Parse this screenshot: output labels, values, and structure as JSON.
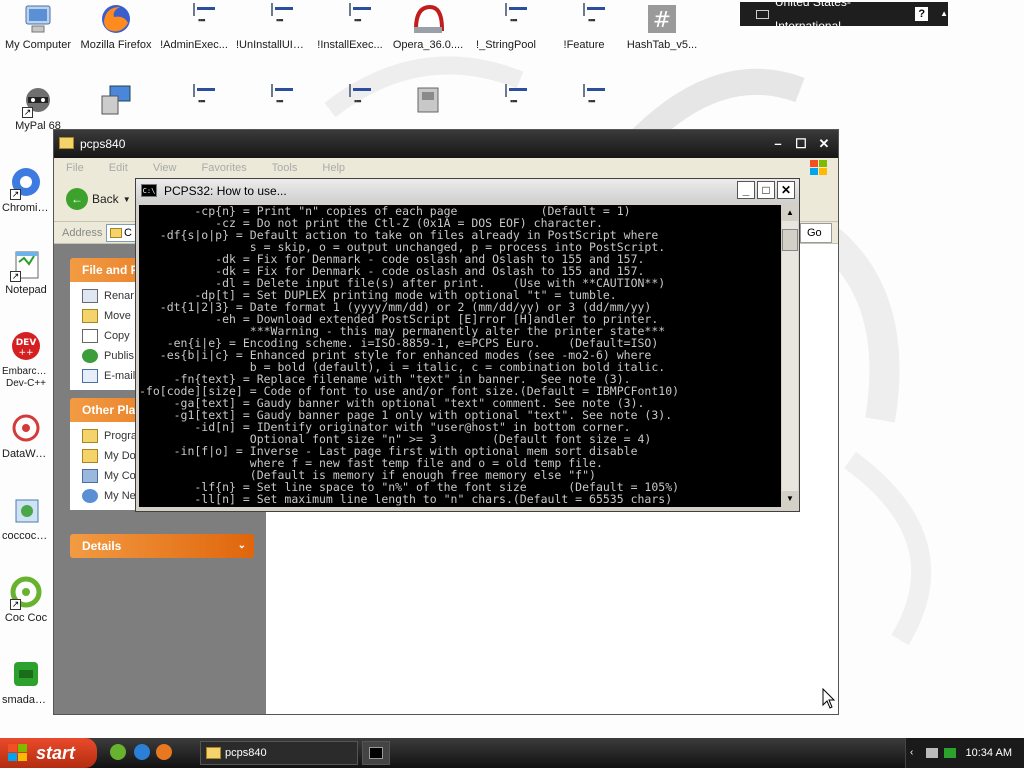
{
  "desktop": {
    "icons": [
      {
        "label": "My Computer"
      },
      {
        "label": "Mozilla Firefox"
      },
      {
        "label": "!AdminExec..."
      },
      {
        "label": "!UnInstallUISeq..."
      },
      {
        "label": "!InstallExec..."
      },
      {
        "label": "Opera_36.0...."
      },
      {
        "label": "!_StringPool"
      },
      {
        "label": "!Feature"
      },
      {
        "label": "HashTab_v5..."
      },
      {
        "label": "MyPal 68"
      },
      {
        "label": "Chromium"
      },
      {
        "label": "Notepad"
      },
      {
        "label": "Embarcadero Dev-C++"
      },
      {
        "label": "DataWagon"
      },
      {
        "label": "coccoc_vi"
      },
      {
        "label": "Coc Coc"
      },
      {
        "label": "smadav20"
      }
    ]
  },
  "language_bar": {
    "label": "United States-International",
    "help": "?"
  },
  "explorer": {
    "title": "pcps840",
    "menu": [
      "File",
      "Edit",
      "View",
      "Favorites",
      "Tools",
      "Help"
    ],
    "back_label": "Back",
    "address_label": "Address",
    "address_value": "C",
    "go_label": "Go",
    "file_folder_tasks": {
      "title": "File and F",
      "items": [
        "Renar",
        "Move",
        "Copy",
        "Publis",
        "E-mail"
      ]
    },
    "other_places": {
      "title": "Other Pla",
      "items": [
        "Progra",
        "My Do",
        "My Co",
        "My Ne"
      ]
    },
    "details": {
      "title": "Details"
    }
  },
  "console": {
    "title": "PCPS32: How to use...",
    "icon_text": "C:\\",
    "lines": [
      "        -cp{n} = Print \"n\" copies of each page            (Default = 1)",
      "           -cz = Do not print the Ctl-Z (0x1A = DOS EOF) character.",
      "   -df{s|o|p} = Default action to take on files already in PostScript where",
      "                s = skip, o = output unchanged, p = process into PostScript.",
      "           -dk = Fix for Denmark - code oslash and Oslash to 155 and 157.",
      "           -dk = Fix for Denmark - code oslash and Oslash to 155 and 157.",
      "           -dl = Delete input file(s) after print.    (Use with **CAUTION**)",
      "        -dp[t] = Set DUPLEX printing mode with optional \"t\" = tumble.",
      "   -dt{1|2|3} = Date format 1 (yyyy/mm/dd) or 2 (mm/dd/yy) or 3 (dd/mm/yy)",
      "           -eh = Download extended PostScript [E]rror [H]andler to printer.",
      "                ***Warning - this may permanently alter the printer state***",
      "    -en{i|e} = Encoding scheme. i=ISO-8859-1, e=PCPS Euro.    (Default=ISO)",
      "   -es{b|i|c} = Enhanced print style for enhanced modes (see -mo2-6) where",
      "                b = bold (default), i = italic, c = combination bold italic.",
      "     -fn{text} = Replace filename with \"text\" in banner.  See note (3).",
      "-fo[code][size] = Code of font to use and/or font size.(Default = IBMPCFont10)",
      "     -ga[text] = Gaudy banner with optional \"text\" comment. See note (3).",
      "     -g1[text] = Gaudy banner page 1 only with optional \"text\". See note (3).",
      "        -id[n] = IDentify originator with \"user@host\" in bottom corner.",
      "                Optional font size \"n\" >= 3        (Default font size = 4)",
      "     -in[f|o] = Inverse - Last page first with optional mem sort disable",
      "                where f = new fast temp file and o = old temp file.",
      "                (Default is memory if enough free memory else \"f\")",
      "        -lf{n} = Set line space to \"n%\" of the font size      (Default = 105%)",
      "        -ll[n] = Set maximum line length to \"n\" chars.(Default = 65535 chars)"
    ]
  },
  "taskbar": {
    "start_label": "start",
    "items": [
      {
        "label": "pcps840"
      },
      {
        "label": ""
      }
    ],
    "clock": "10:34 AM"
  },
  "colors": {
    "start": "#d73b1c",
    "taskpanel_header": "#e8751e",
    "console_bg": "#000000",
    "console_fg": "#c8c8c8"
  }
}
